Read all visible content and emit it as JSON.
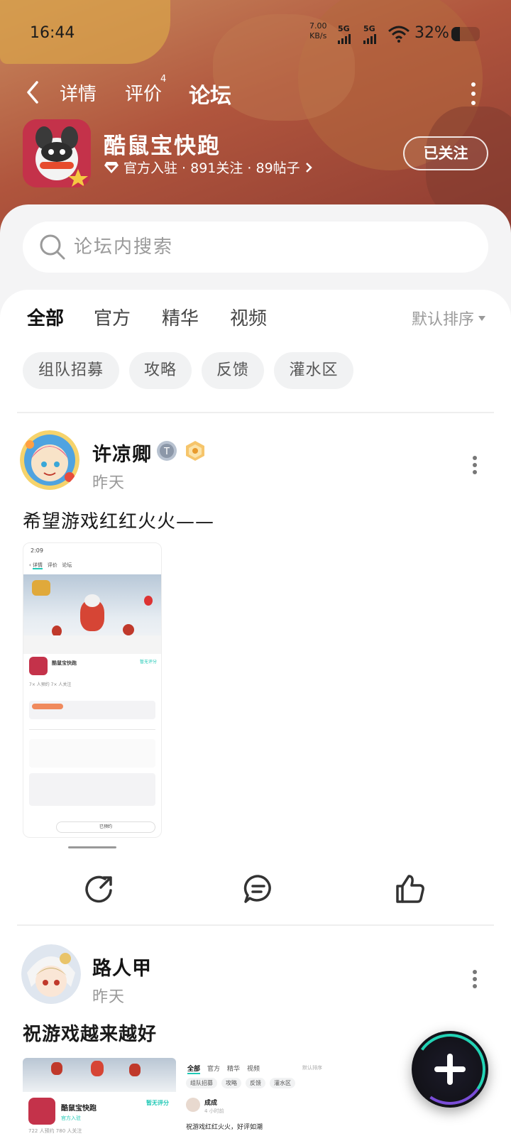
{
  "status_bar": {
    "time": "16:44",
    "net_speed_value": "7.00",
    "net_speed_unit": "KB/s",
    "signal_1": "5G",
    "signal_2": "5G",
    "battery": "32%"
  },
  "nav": {
    "tabs": [
      {
        "label": "详情"
      },
      {
        "label": "评价",
        "badge": "4"
      },
      {
        "label": "论坛",
        "active": true
      }
    ]
  },
  "app": {
    "name": "酷鼠宝快跑",
    "meta": "官方入驻 · 891关注 · 89帖子",
    "follow_label": "已关注"
  },
  "search": {
    "placeholder": "论坛内搜索"
  },
  "filters": {
    "tabs": [
      "全部",
      "官方",
      "精华",
      "视频"
    ],
    "sort_label": "默认排序",
    "chips": [
      "组队招募",
      "攻略",
      "反馈",
      "灌水区"
    ]
  },
  "posts": [
    {
      "username": "许凉卿",
      "time": "昨天",
      "title": "希望游戏红红火火——",
      "screenshot": {
        "status_time": "2:09",
        "tabs": [
          "详情",
          "评价",
          "论坛"
        ],
        "app_name": "酷鼠宝快跑",
        "rating": "暂无评分",
        "stats": "7× 人预约   7× 人关注",
        "button": "已预约"
      }
    },
    {
      "username": "路人甲",
      "time": "昨天",
      "title": "祝游戏越来越好",
      "preview": {
        "app_name": "酷鼠宝快跑",
        "rating": "暂无评分",
        "official": "官方入驻",
        "stats": "722 人预约   780 人关注",
        "tabs": [
          "全部",
          "官方",
          "精华",
          "视频"
        ],
        "sort": "默认排序",
        "chips": [
          "组队招募",
          "攻略",
          "反馈",
          "灌水区"
        ],
        "user": "成成",
        "time": "4 小时前",
        "text": "祝游戏红红火火，好评如潮"
      }
    }
  ],
  "colors": {
    "accent": "#1fc8b5",
    "banner": "#b0553d",
    "fab": "#121218"
  }
}
